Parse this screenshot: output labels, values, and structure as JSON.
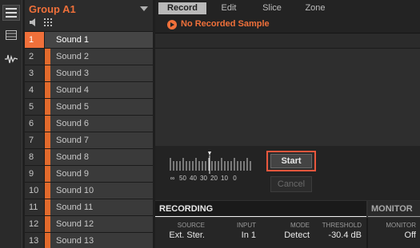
{
  "group": {
    "title": "Group A1",
    "sounds": [
      {
        "num": "1",
        "name": "Sound 1",
        "selected": true
      },
      {
        "num": "2",
        "name": "Sound 2"
      },
      {
        "num": "3",
        "name": "Sound 3"
      },
      {
        "num": "4",
        "name": "Sound 4"
      },
      {
        "num": "5",
        "name": "Sound 5"
      },
      {
        "num": "6",
        "name": "Sound 6"
      },
      {
        "num": "7",
        "name": "Sound 7"
      },
      {
        "num": "8",
        "name": "Sound 8"
      },
      {
        "num": "9",
        "name": "Sound 9"
      },
      {
        "num": "10",
        "name": "Sound 10"
      },
      {
        "num": "11",
        "name": "Sound 11"
      },
      {
        "num": "12",
        "name": "Sound 12"
      },
      {
        "num": "13",
        "name": "Sound 13"
      }
    ]
  },
  "tabs": [
    "Record",
    "Edit",
    "Slice",
    "Zone"
  ],
  "active_tab": "Record",
  "sample_info": "No Recorded Sample",
  "meter": {
    "labels": [
      "∞",
      "50",
      "40",
      "30",
      "20",
      "10",
      "0"
    ]
  },
  "buttons": {
    "start": "Start",
    "cancel": "Cancel"
  },
  "recording": {
    "header": "RECORDING",
    "params": [
      {
        "label": "SOURCE",
        "value": "Ext. Ster."
      },
      {
        "label": "INPUT",
        "value": "In 1"
      },
      {
        "label": "MODE",
        "value": "Detect"
      },
      {
        "label": "THRESHOLD",
        "value": "-30.4 dB"
      }
    ]
  },
  "monitor": {
    "header": "MONITOR",
    "params": [
      {
        "label": "MONITOR",
        "value": "Off"
      }
    ]
  },
  "colors": {
    "accent": "#f0703a",
    "highlight_box": "#e9573d"
  }
}
